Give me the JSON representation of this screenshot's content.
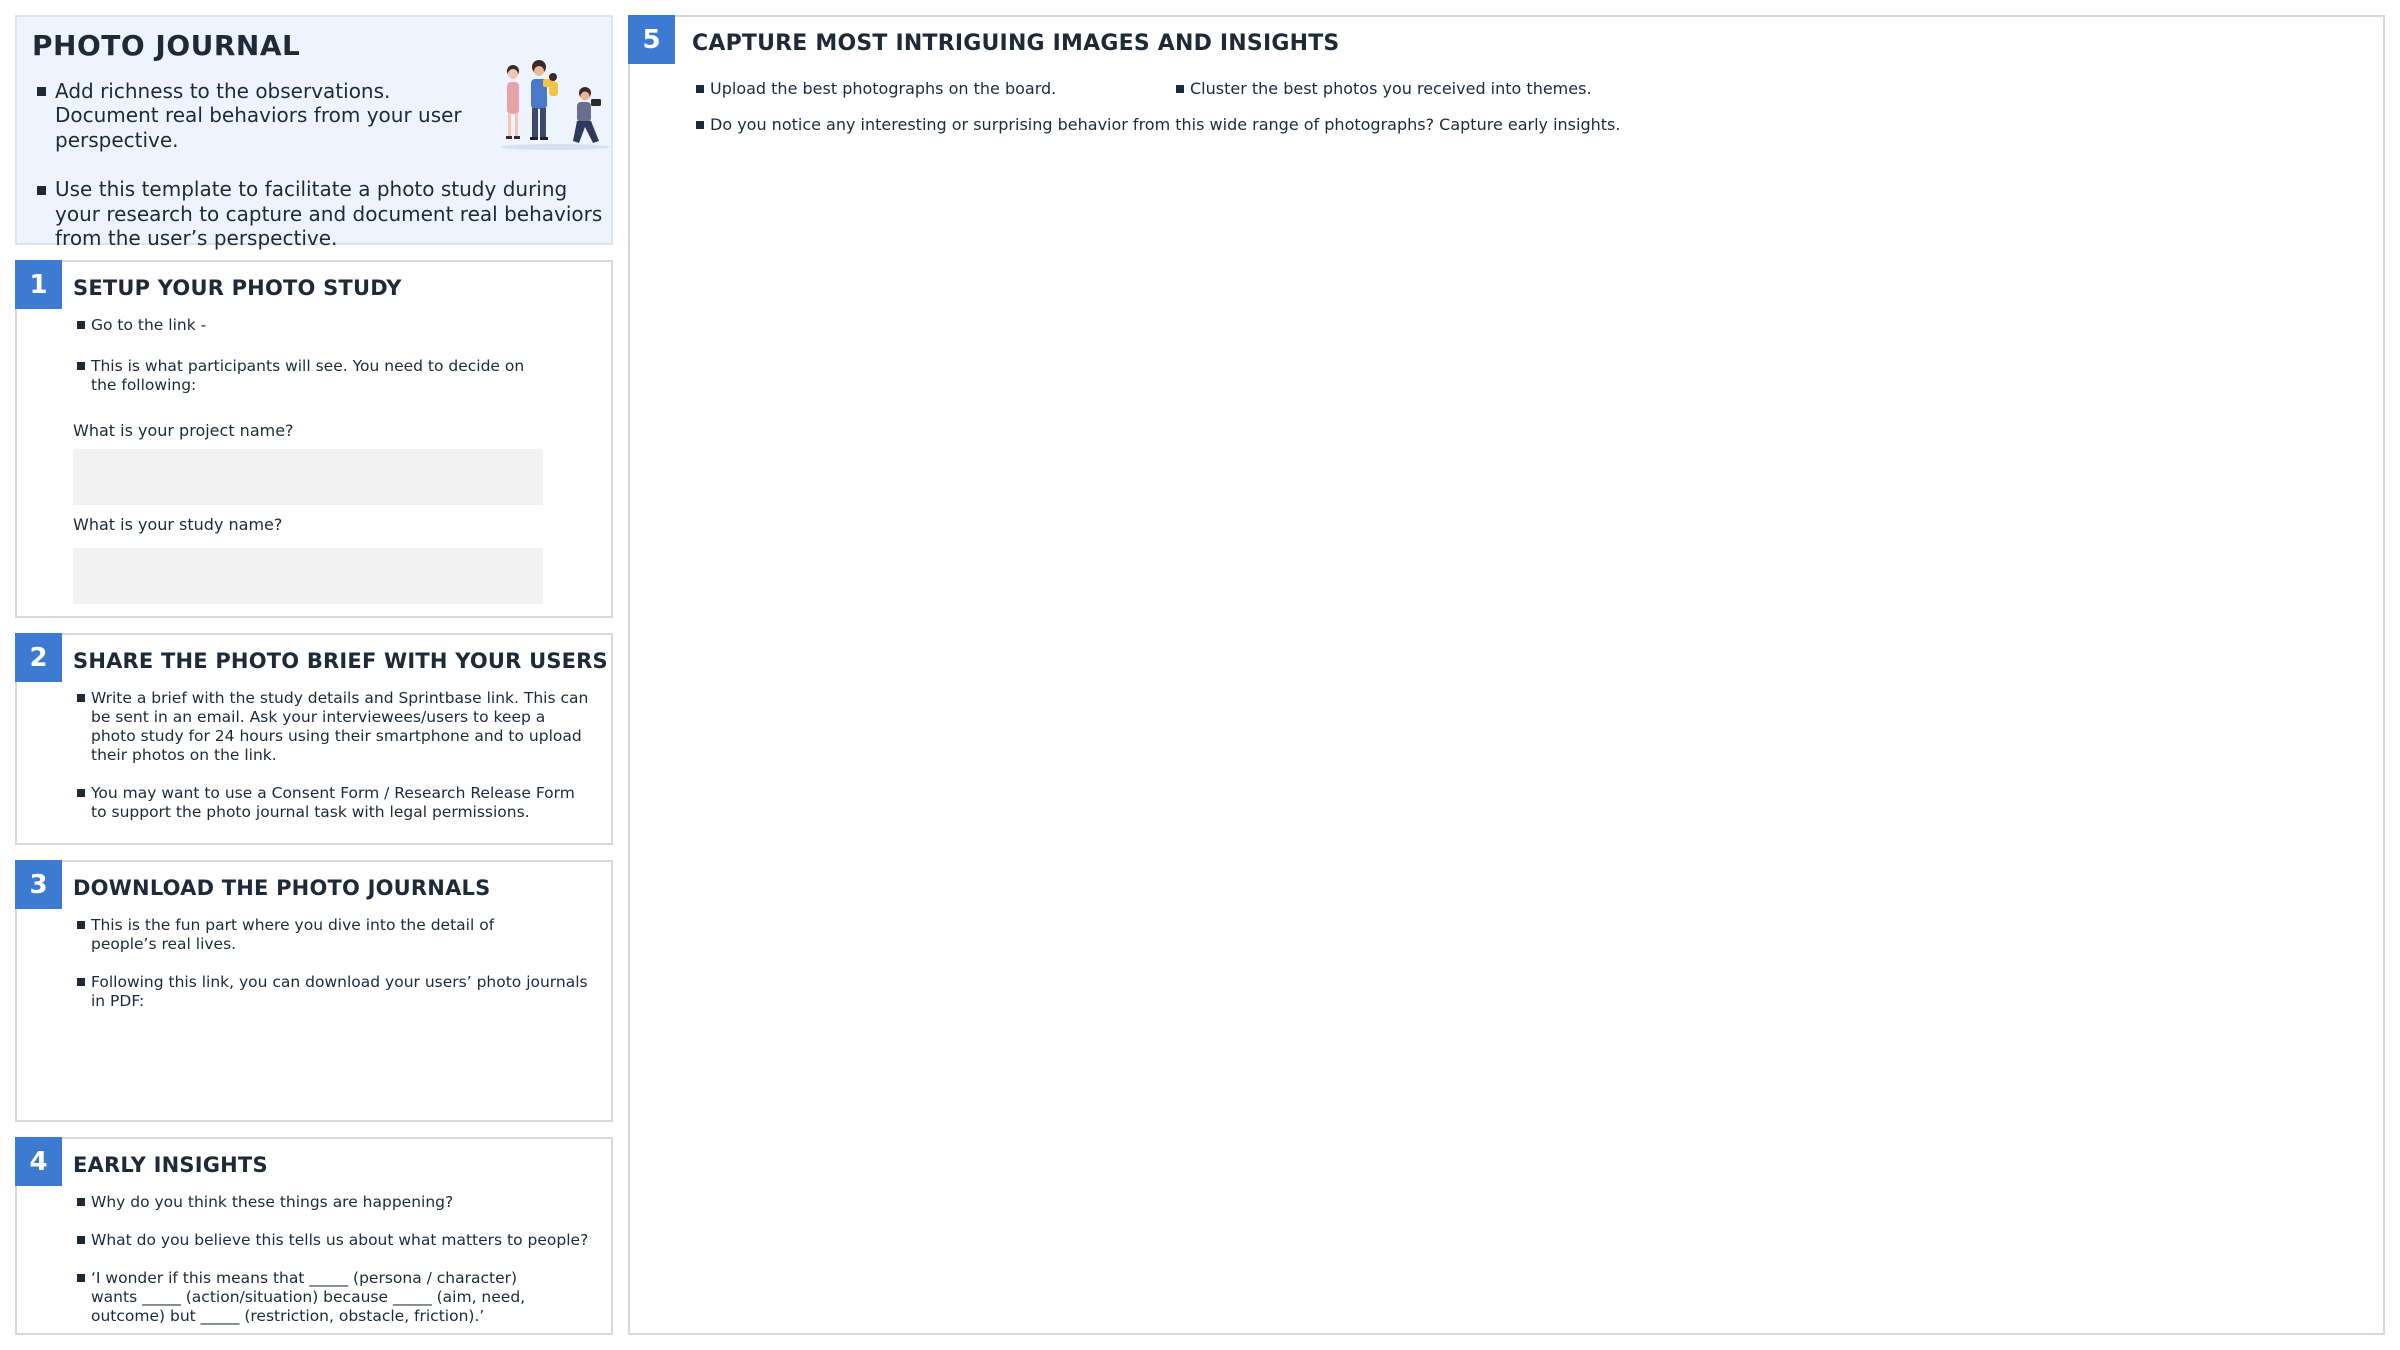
{
  "intro": {
    "title": "PHOTO JOURNAL",
    "bullets": [
      "Add richness to the observations. Document real behaviors from your user perspective.",
      "Use this template to facilitate a photo study during your research to capture and document real behaviors from the user’s perspective."
    ]
  },
  "sections": {
    "s1": {
      "number": "1",
      "title": "SETUP YOUR PHOTO STUDY",
      "bullets": [
        "Go to the link -",
        "This is what participants will see. You need to decide on the following:"
      ],
      "project_label": "What is your project name?",
      "project_value": "",
      "study_label": "What is your study name?",
      "study_value": ""
    },
    "s2": {
      "number": "2",
      "title": "SHARE THE PHOTO BRIEF WITH YOUR USERS",
      "bullets": [
        "Write a brief with the study details and Sprintbase link. This can be sent in an email. Ask your interviewees/users to keep a photo study for 24 hours using their smartphone and to upload their photos on the link.",
        "You may want to use a Consent Form / Research Release Form to support the photo journal task with legal permissions."
      ]
    },
    "s3": {
      "number": "3",
      "title": "DOWNLOAD THE PHOTO JOURNALS",
      "bullets": [
        "This is the fun part where you dive into the detail of people’s real lives.",
        "Following this link, you can download your users’ photo journals in PDF:"
      ]
    },
    "s4": {
      "number": "4",
      "title": "EARLY INSIGHTS",
      "bullets": [
        "Why do you think these things are happening?",
        "What do you believe this tells us about what matters to people?",
        "‘I wonder if this means that _____ (persona / character) wants _____ (action/situation) because _____ (aim, need, outcome) but _____ (restriction, obstacle, friction).’"
      ]
    },
    "s5": {
      "number": "5",
      "title": "CAPTURE MOST INTRIGUING IMAGES AND INSIGHTS",
      "bullets": [
        "Upload the best photographs on the board.",
        "Cluster the best photos you received into themes.",
        "Do you notice any interesting or surprising behavior from this wide range of photographs? Capture early insights."
      ]
    }
  },
  "colors": {
    "accent": "#3d7bd3",
    "intro_bg": "#eef4fd",
    "text": "#1e2a38",
    "input_bg": "#f2f2f2"
  },
  "icons": {
    "illustration": "people-taking-photos-illustration"
  }
}
